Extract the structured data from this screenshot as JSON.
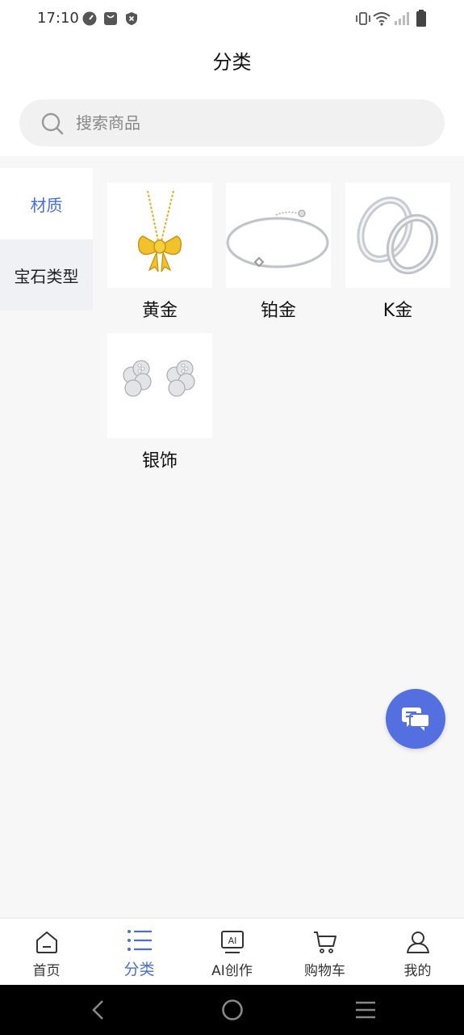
{
  "status": {
    "time": "17:10"
  },
  "header": {
    "title": "分类"
  },
  "search": {
    "placeholder": "搜索商品"
  },
  "sidebar": {
    "items": [
      {
        "label": "材质",
        "active": true
      },
      {
        "label": "宝石类型",
        "active": false
      }
    ]
  },
  "products": [
    {
      "label": "黄金",
      "image": "gold-bow-necklace"
    },
    {
      "label": "铂金",
      "image": "platinum-bracelet"
    },
    {
      "label": "K金",
      "image": "k-gold-couple-rings"
    },
    {
      "label": "银饰",
      "image": "silver-clover-earrings"
    }
  ],
  "tabbar": {
    "items": [
      {
        "label": "首页",
        "icon": "home-icon"
      },
      {
        "label": "分类",
        "icon": "category-list-icon",
        "active": true
      },
      {
        "label": "AI创作",
        "icon": "ai-icon"
      },
      {
        "label": "购物车",
        "icon": "cart-icon"
      },
      {
        "label": "我的",
        "icon": "user-icon"
      }
    ]
  },
  "colors": {
    "accent": "#4a6fd6",
    "fab": "#5470e0",
    "background": "#f7f7f7"
  }
}
